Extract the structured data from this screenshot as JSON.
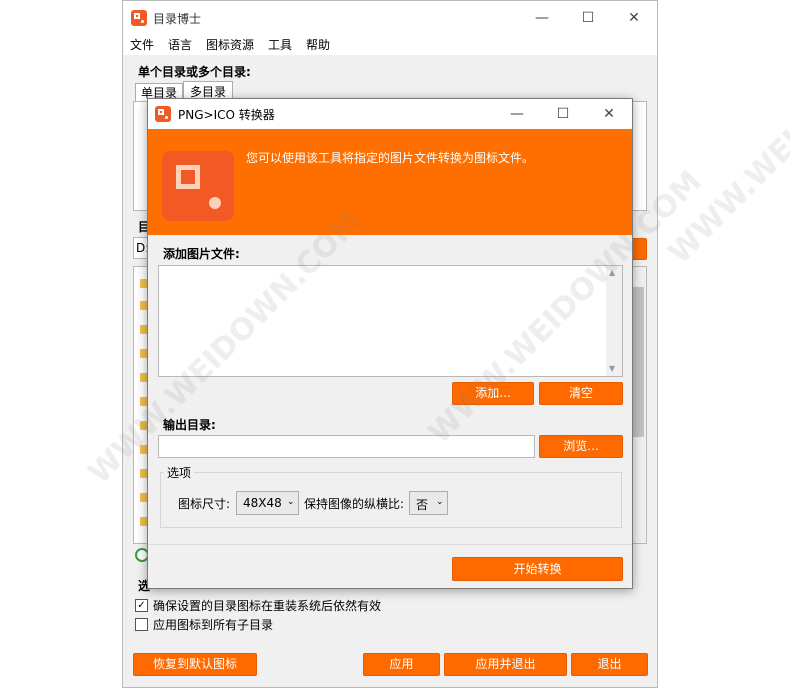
{
  "main": {
    "title": "目录博士",
    "menu": [
      "文件",
      "语言",
      "图标资源",
      "工具",
      "帮助"
    ],
    "section_label": "单个目录或多个目录:",
    "tabs": [
      "单目录",
      "多目录"
    ],
    "dir_label_fragment": "目",
    "path_fragment": "D:",
    "options_label_fragment": "选",
    "checkbox_keep": "确保设置的目录图标在重装系统后依然有效",
    "checkbox_apply_sub": "应用图标到所有子目录",
    "buttons": {
      "restore": "恢复到默认图标",
      "apply": "应用",
      "apply_exit": "应用并退出",
      "exit": "退出"
    }
  },
  "dialog": {
    "title": "PNG>ICO 转换器",
    "banner_text": "您可以使用该工具将指定的图片文件转换为图标文件。",
    "add_files_label": "添加图片文件:",
    "add_button": "添加...",
    "clear_button": "清空",
    "output_label": "输出目录:",
    "output_value": "",
    "browse_button": "浏览...",
    "options_group": "选项",
    "icon_size_label": "图标尺寸:",
    "icon_size_value": "48X48",
    "keep_ratio_label": "保持图像的纵横比:",
    "keep_ratio_value": "否",
    "start_button": "开始转换"
  },
  "watermark": "WWW.WEIDOWN.COM",
  "colors": {
    "accent": "#ff6a00",
    "banner": "#ff6f00",
    "icon": "#f15a24"
  }
}
